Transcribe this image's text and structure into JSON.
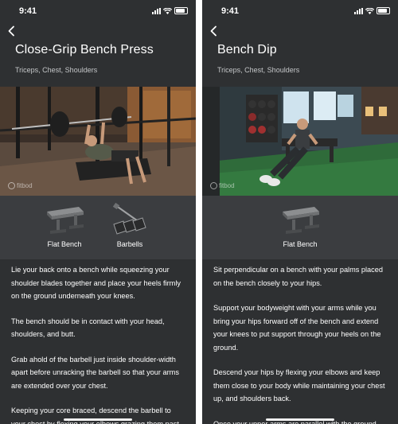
{
  "screens": [
    {
      "status_time": "9:41",
      "title": "Close-Grip Bench Press",
      "subtitle": "Triceps, Chest, Shoulders",
      "watermark": "fitbod",
      "equipment": [
        {
          "label": "Flat Bench",
          "icon": "flat-bench-icon"
        },
        {
          "label": "Barbells",
          "icon": "barbells-icon"
        }
      ],
      "instructions": [
        "Lie your back onto a bench while squeezing your shoulder blades together and place your heels firmly on the ground underneath your knees.",
        "The bench should be in contact with your head, shoulders, and butt.",
        "Grab ahold of the barbell just inside shoulder-width apart before unracking the barbell so that your arms are extended over your chest.",
        "Keeping your core braced, descend the barbell to your chest by flexing your elbows grazing them past"
      ]
    },
    {
      "status_time": "9:41",
      "title": "Bench Dip",
      "subtitle": "Triceps, Chest, Shoulders",
      "watermark": "fitbod",
      "equipment": [
        {
          "label": "Flat Bench",
          "icon": "flat-bench-icon"
        }
      ],
      "instructions": [
        "Sit perpendicular on a bench with your palms placed on the bench closely to your hips.",
        "Support your bodyweight with your arms while you bring your hips forward off of the bench and extend your knees to put support through your heels on the ground.",
        "Descend your hips by flexing your elbows and keep them close to your body while maintaining your chest up, and shoulders back.",
        "Once your upper arms are parallel with the ground,"
      ]
    }
  ]
}
